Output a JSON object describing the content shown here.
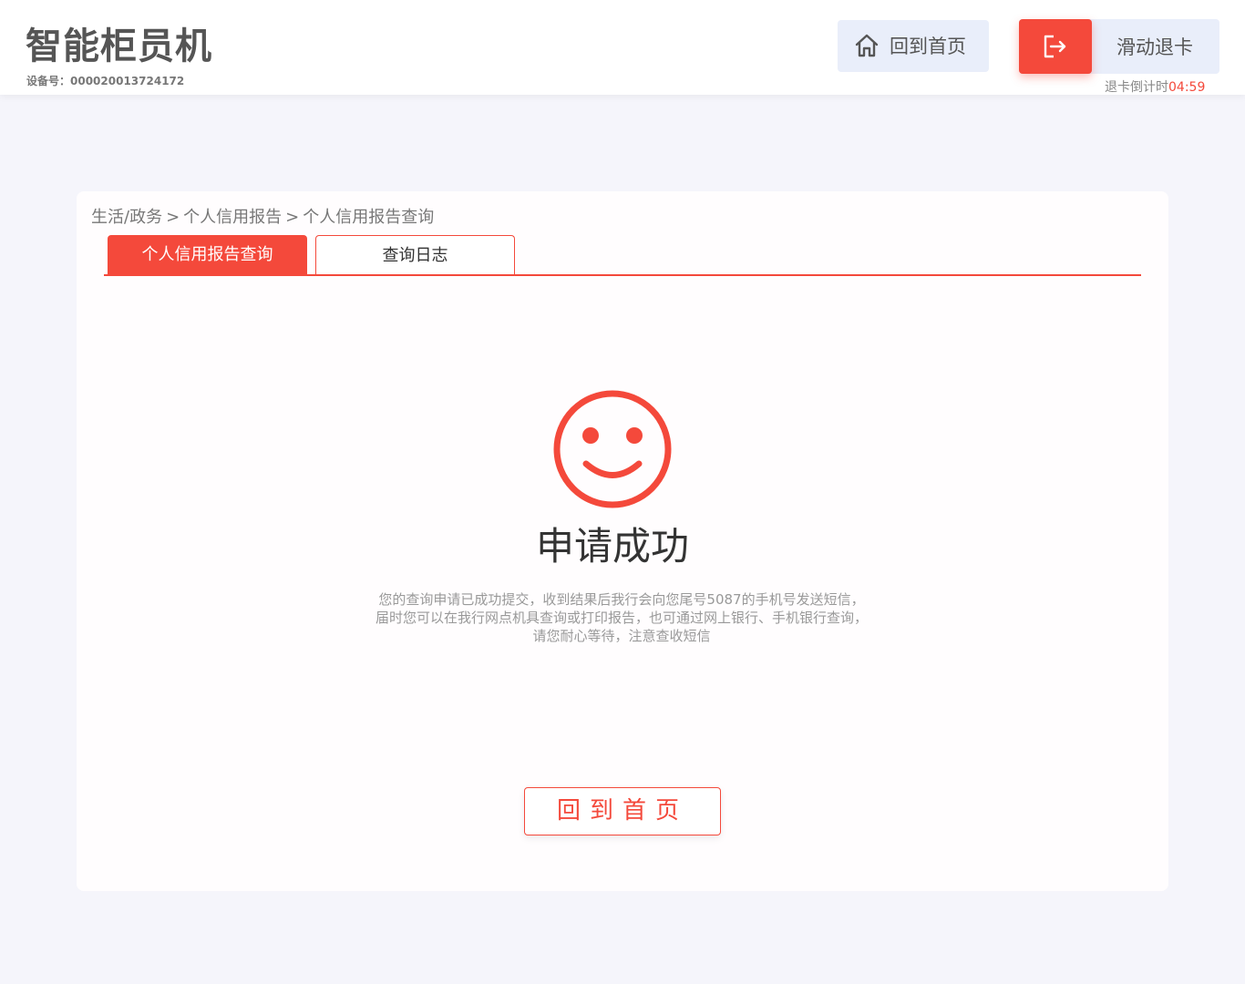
{
  "header": {
    "title": "智能柜员机",
    "device_label": "设备号：000020013724172",
    "home_button": {
      "label": "回到首页",
      "icon": "home-icon"
    },
    "exit_button": {
      "label": "滑动退卡",
      "icon": "exit-icon"
    },
    "countdown": {
      "label": "退卡倒计时",
      "time": "04:59"
    }
  },
  "breadcrumb": {
    "items": [
      "生活/政务",
      "个人信用报告",
      "个人信用报告查询"
    ],
    "separator": ">"
  },
  "tabs": [
    {
      "label": "个人信用报告查询",
      "active": true
    },
    {
      "label": "查询日志",
      "active": false
    }
  ],
  "result": {
    "icon": "smile-icon",
    "title": "申请成功",
    "description": "您的查询申请已成功提交，收到结果后我行会向您尾号5087的手机号发送短信，届时您可以在我行网点机具查询或打印报告，也可通过网上银行、手机银行查询，请您耐心等待，注意查收短信"
  },
  "bottom_button": {
    "label": "回到首页"
  },
  "colors": {
    "accent": "#f4493b",
    "button_bg": "#e9eefa",
    "page_bg": "#f5f5fb"
  }
}
